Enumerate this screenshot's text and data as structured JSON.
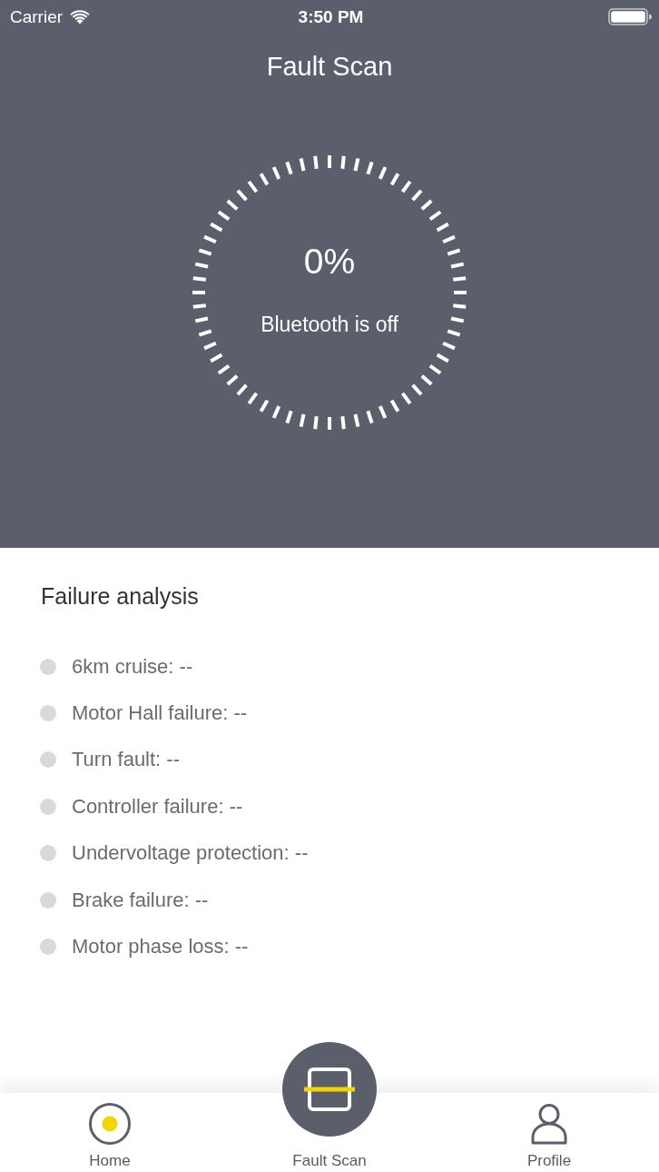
{
  "status_bar": {
    "carrier": "Carrier",
    "time": "3:50 PM"
  },
  "nav": {
    "title": "Fault Scan"
  },
  "scan": {
    "percent": "0%",
    "message": "Bluetooth is off"
  },
  "failure_analysis": {
    "title": "Failure analysis",
    "items": [
      "6km cruise: --",
      "Motor Hall failure: --",
      "Turn fault: --",
      "Controller failure: --",
      "Undervoltage protection: --",
      "Brake failure: --",
      "Motor phase loss: --"
    ]
  },
  "tab_bar": {
    "tabs": [
      {
        "label": "Home",
        "kind": "plain"
      },
      {
        "label": "Fault Scan",
        "kind": "raised"
      },
      {
        "label": "Profile",
        "kind": "plain"
      }
    ]
  }
}
